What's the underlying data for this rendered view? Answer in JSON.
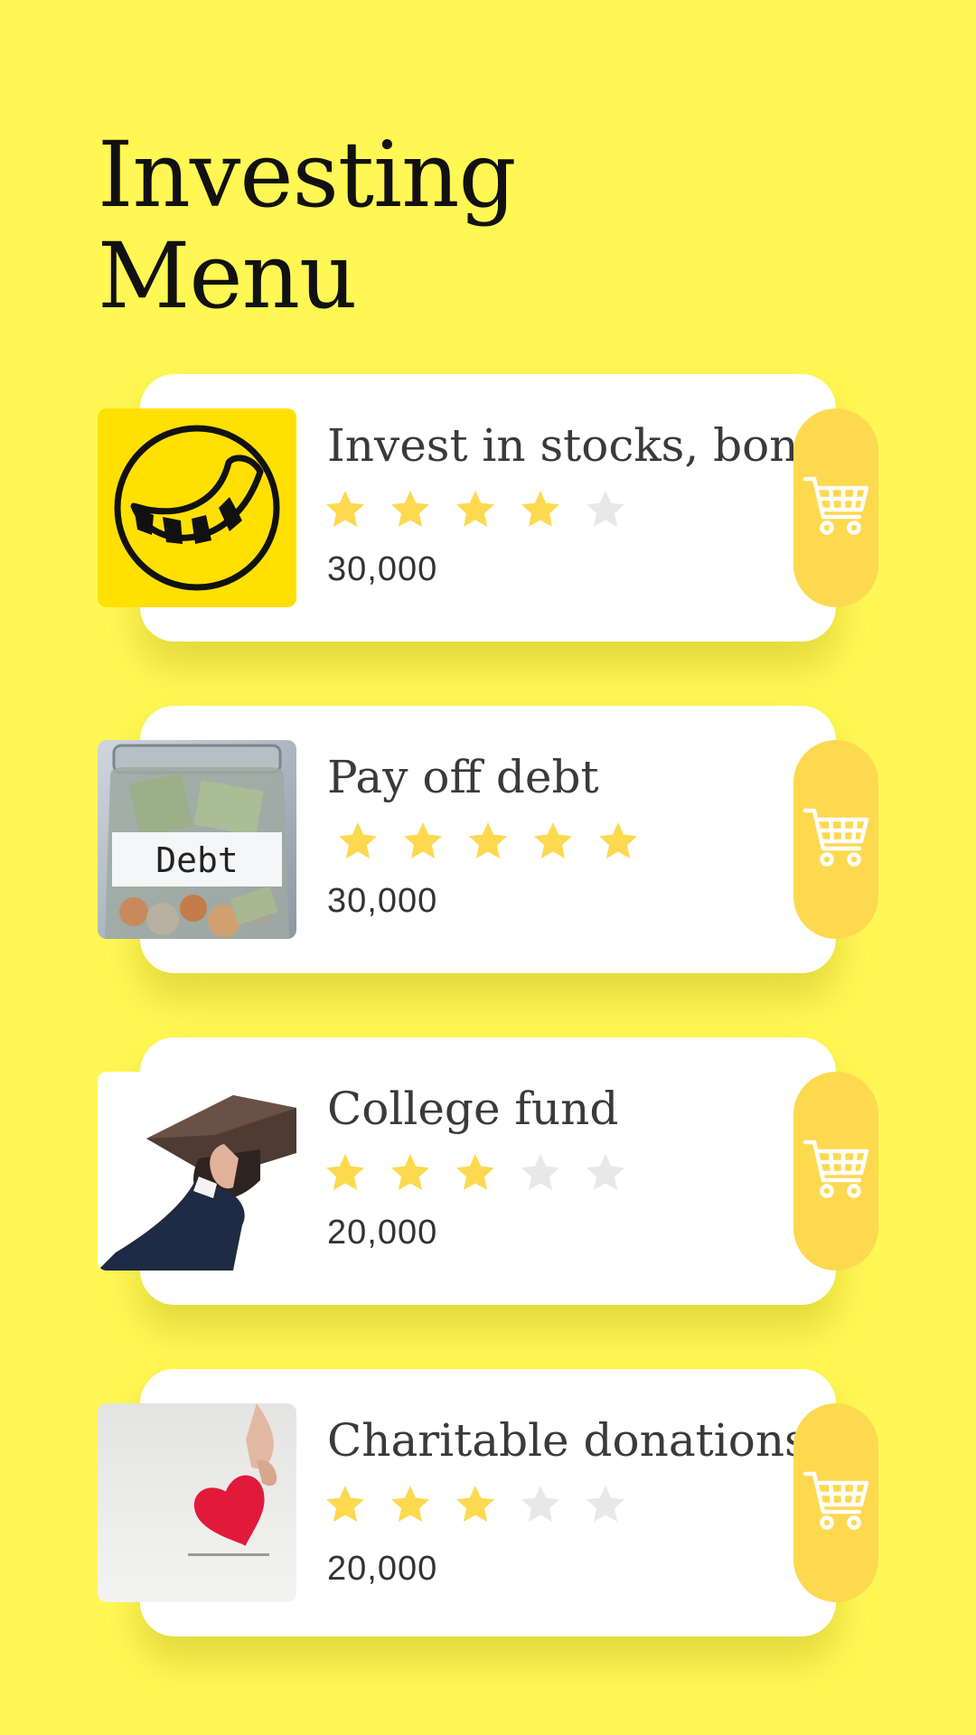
{
  "page": {
    "title_line1": "Investing",
    "title_line2": "Menu"
  },
  "colors": {
    "background": "#fff753",
    "card": "#ffffff",
    "cart_button": "#fdd94f",
    "star_filled": "#fdd94f",
    "star_empty": "#e8e8e8"
  },
  "items": [
    {
      "title": "Invest in stocks, bonds",
      "rating": 4,
      "rating_max": 5,
      "price": "30,000",
      "image": "smiling-face-logo"
    },
    {
      "title": "Pay off debt",
      "rating": 5,
      "rating_max": 5,
      "price": "30,000",
      "image": "debt-jar-photo",
      "image_label": "Debt"
    },
    {
      "title": "College fund",
      "rating": 3,
      "rating_max": 5,
      "price": "20,000",
      "image": "graduation-cap-photo"
    },
    {
      "title": "Charitable donations",
      "rating": 3,
      "rating_max": 5,
      "price": "20,000",
      "image": "heart-donation-photo"
    }
  ],
  "icons": {
    "cart": "shopping-cart-icon",
    "star": "star-icon"
  }
}
